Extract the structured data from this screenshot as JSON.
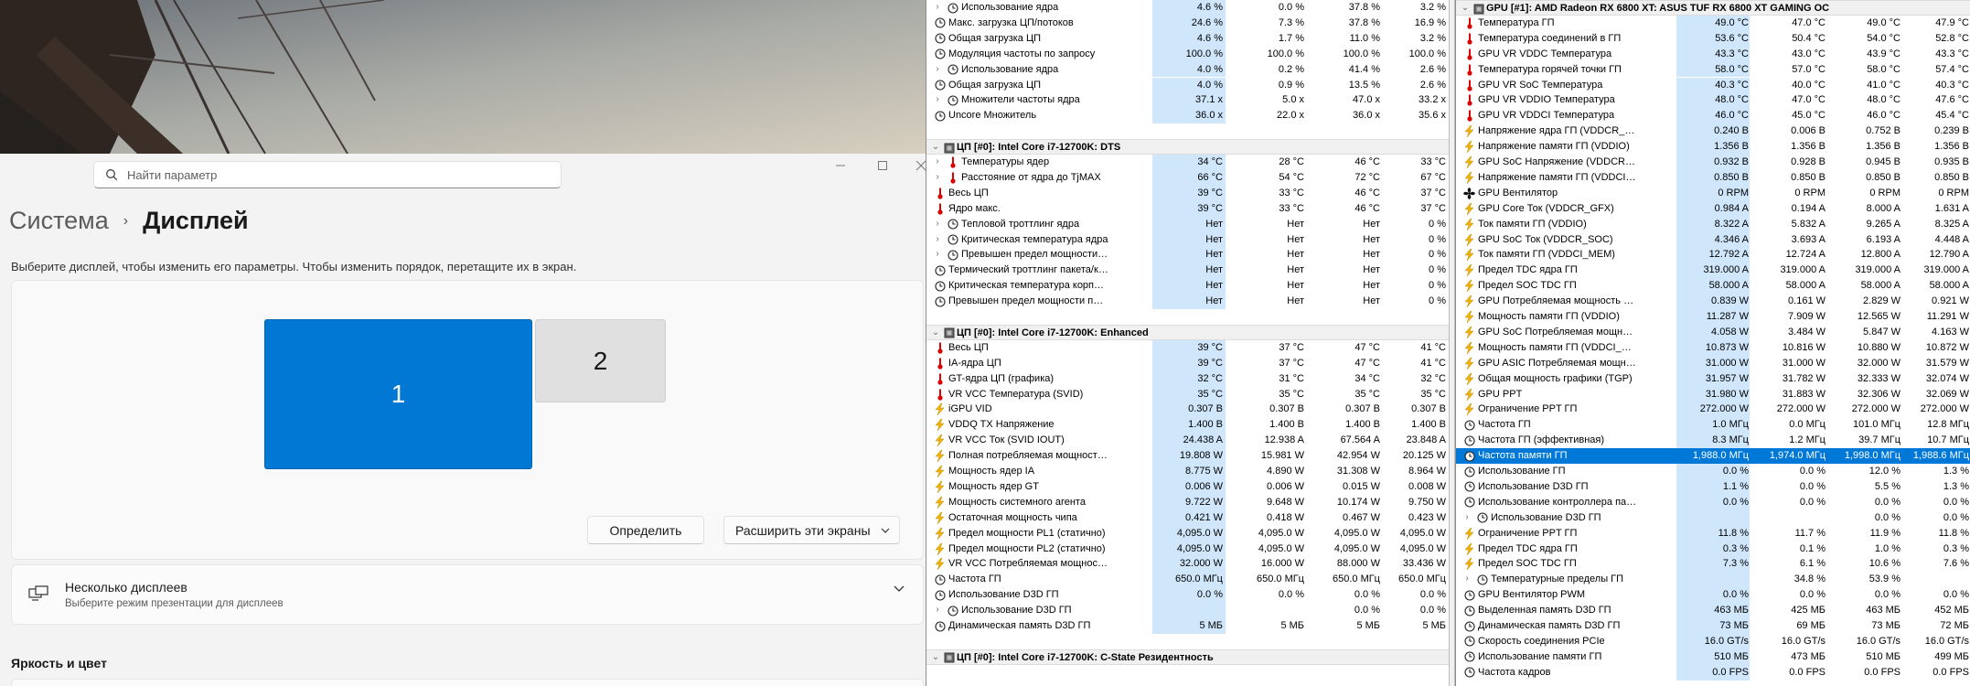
{
  "settings": {
    "search_placeholder": "Найти параметр",
    "breadcrumb_parent": "Система",
    "breadcrumb_current": "Дисплей",
    "description": "Выберите дисплей, чтобы изменить его параметры. Чтобы изменить порядок, перетащите их в экран.",
    "monitor1_label": "1",
    "monitor2_label": "2",
    "identify_button": "Определить",
    "extend_dropdown": "Расширить эти экраны",
    "multiple_displays_title": "Несколько дисплеев",
    "multiple_displays_subtitle": "Выберите режим презентации для дисплеев",
    "brightness_section": "Яркость и цвет"
  },
  "left_pane": {
    "rows": [
      {
        "t": "s",
        "ind": 1,
        "ex": "›",
        "ic": "clock",
        "name": "Использование ядра",
        "v": [
          "4.6 %",
          "0.0 %",
          "37.8 %",
          "3.2 %"
        ]
      },
      {
        "t": "s",
        "ind": 0,
        "ex": "",
        "ic": "clock",
        "name": "Макс. загрузка ЦП/потоков",
        "v": [
          "24.6 %",
          "7.3 %",
          "37.8 %",
          "16.9 %"
        ]
      },
      {
        "t": "s",
        "ind": 0,
        "ex": "",
        "ic": "clock",
        "name": "Общая загрузка ЦП",
        "v": [
          "4.6 %",
          "1.7 %",
          "11.0 %",
          "3.2 %"
        ]
      },
      {
        "t": "s",
        "ind": 0,
        "ex": "",
        "ic": "clock",
        "name": "Модуляция частоты по запросу",
        "v": [
          "100.0 %",
          "100.0 %",
          "100.0 %",
          "100.0 %"
        ]
      },
      {
        "t": "s",
        "ind": 1,
        "ex": "›",
        "ic": "clock",
        "name": "Использование ядра",
        "v": [
          "4.0 %",
          "0.2 %",
          "41.4 %",
          "2.6 %"
        ]
      },
      {
        "t": "s",
        "ind": 0,
        "ex": "",
        "ic": "clock",
        "name": "Общая загрузка ЦП",
        "v": [
          "4.0 %",
          "0.9 %",
          "13.5 %",
          "2.6 %"
        ]
      },
      {
        "t": "s",
        "ind": 1,
        "ex": "›",
        "ic": "clock",
        "name": "Множители частоты ядра",
        "v": [
          "37.1 x",
          "5.0 x",
          "47.0 x",
          "33.2 x"
        ]
      },
      {
        "t": "s",
        "ind": 0,
        "ex": "",
        "ic": "clock",
        "name": "Uncore Множитель",
        "v": [
          "36.0 x",
          "22.0 x",
          "36.0 x",
          "35.6 x"
        ]
      },
      {
        "t": "blank"
      },
      {
        "t": "h",
        "name": "ЦП [#0]: Intel Core i7-12700K: DTS"
      },
      {
        "t": "s",
        "ind": 1,
        "ex": "›",
        "ic": "therm",
        "name": "Температуры ядер",
        "v": [
          "34 °C",
          "28 °C",
          "46 °C",
          "33 °C"
        ]
      },
      {
        "t": "s",
        "ind": 1,
        "ex": "›",
        "ic": "therm",
        "name": "Расстояние от ядра до TjMAX",
        "v": [
          "66 °C",
          "54 °C",
          "72 °C",
          "67 °C"
        ]
      },
      {
        "t": "s",
        "ind": 0,
        "ex": "",
        "ic": "therm",
        "name": "Весь ЦП",
        "v": [
          "39 °C",
          "33 °C",
          "46 °C",
          "37 °C"
        ]
      },
      {
        "t": "s",
        "ind": 0,
        "ex": "",
        "ic": "therm",
        "name": "Ядро макс.",
        "v": [
          "39 °C",
          "33 °C",
          "46 °C",
          "37 °C"
        ]
      },
      {
        "t": "s",
        "ind": 1,
        "ex": "›",
        "ic": "clock",
        "name": "Тепловой троттлинг ядра",
        "v": [
          "Нет",
          "Нет",
          "Нет",
          "0 %"
        ]
      },
      {
        "t": "s",
        "ind": 1,
        "ex": "›",
        "ic": "clock",
        "name": "Критическая температура ядра",
        "v": [
          "Нет",
          "Нет",
          "Нет",
          "0 %"
        ]
      },
      {
        "t": "s",
        "ind": 1,
        "ex": "›",
        "ic": "clock",
        "name": "Превышен предел мощности ядра",
        "v": [
          "Нет",
          "Нет",
          "Нет",
          "0 %"
        ]
      },
      {
        "t": "s",
        "ind": 0,
        "ex": "",
        "ic": "clock",
        "name": "Термический троттлинг пакета/кольца",
        "v": [
          "Нет",
          "Нет",
          "Нет",
          "0 %"
        ]
      },
      {
        "t": "s",
        "ind": 0,
        "ex": "",
        "ic": "clock",
        "name": "Критическая температура корпуса/к...",
        "v": [
          "Нет",
          "Нет",
          "Нет",
          "0 %"
        ]
      },
      {
        "t": "s",
        "ind": 0,
        "ex": "",
        "ic": "clock",
        "name": "Превышен предел мощности пакета/...",
        "v": [
          "Нет",
          "Нет",
          "Нет",
          "0 %"
        ]
      },
      {
        "t": "blank"
      },
      {
        "t": "h",
        "name": "ЦП [#0]: Intel Core i7-12700K: Enhanced"
      },
      {
        "t": "s",
        "ind": 0,
        "ex": "",
        "ic": "therm",
        "name": "Весь ЦП",
        "v": [
          "39 °C",
          "37 °C",
          "47 °C",
          "41 °C"
        ]
      },
      {
        "t": "s",
        "ind": 0,
        "ex": "",
        "ic": "therm",
        "name": "IA-ядра ЦП",
        "v": [
          "39 °C",
          "37 °C",
          "47 °C",
          "41 °C"
        ]
      },
      {
        "t": "s",
        "ind": 0,
        "ex": "",
        "ic": "therm",
        "name": "GT-ядра ЦП (графика)",
        "v": [
          "32 °C",
          "31 °C",
          "34 °C",
          "32 °C"
        ]
      },
      {
        "t": "s",
        "ind": 0,
        "ex": "",
        "ic": "therm",
        "name": "VR VCC Температура (SVID)",
        "v": [
          "35 °C",
          "35 °C",
          "35 °C",
          "35 °C"
        ]
      },
      {
        "t": "s",
        "ind": 0,
        "ex": "",
        "ic": "bolt",
        "name": "iGPU VID",
        "v": [
          "0.307 В",
          "0.307 В",
          "0.307 В",
          "0.307 В"
        ]
      },
      {
        "t": "s",
        "ind": 0,
        "ex": "",
        "ic": "bolt",
        "name": "VDDQ TX Напряжение",
        "v": [
          "1.400 В",
          "1.400 В",
          "1.400 В",
          "1.400 В"
        ]
      },
      {
        "t": "s",
        "ind": 0,
        "ex": "",
        "ic": "bolt",
        "name": "VR VCC Ток (SVID IOUT)",
        "v": [
          "24.438 A",
          "12.938 A",
          "67.564 A",
          "23.848 A"
        ]
      },
      {
        "t": "s",
        "ind": 0,
        "ex": "",
        "ic": "bolt",
        "name": "Полная потребляемая мощность ЦП",
        "v": [
          "19.808 W",
          "15.981 W",
          "42.954 W",
          "20.125 W"
        ]
      },
      {
        "t": "s",
        "ind": 0,
        "ex": "",
        "ic": "bolt",
        "name": "Мощность ядер IA",
        "v": [
          "8.775 W",
          "4.890 W",
          "31.308 W",
          "8.964 W"
        ]
      },
      {
        "t": "s",
        "ind": 0,
        "ex": "",
        "ic": "bolt",
        "name": "Мощность ядер GT",
        "v": [
          "0.006 W",
          "0.006 W",
          "0.015 W",
          "0.008 W"
        ]
      },
      {
        "t": "s",
        "ind": 0,
        "ex": "",
        "ic": "bolt",
        "name": "Мощность системного агента",
        "v": [
          "9.722 W",
          "9.648 W",
          "10.174 W",
          "9.750 W"
        ]
      },
      {
        "t": "s",
        "ind": 0,
        "ex": "",
        "ic": "bolt",
        "name": "Остаточная мощность чипа",
        "v": [
          "0.421 W",
          "0.418 W",
          "0.467 W",
          "0.423 W"
        ]
      },
      {
        "t": "s",
        "ind": 0,
        "ex": "",
        "ic": "bolt",
        "name": "Предел мощности PL1 (статично)",
        "v": [
          "4,095.0 W",
          "4,095.0 W",
          "4,095.0 W",
          "4,095.0 W"
        ]
      },
      {
        "t": "s",
        "ind": 0,
        "ex": "",
        "ic": "bolt",
        "name": "Предел мощности PL2 (статично)",
        "v": [
          "4,095.0 W",
          "4,095.0 W",
          "4,095.0 W",
          "4,095.0 W"
        ]
      },
      {
        "t": "s",
        "ind": 0,
        "ex": "",
        "ic": "bolt",
        "name": "VR VCC Потребляемая мощность (SVI...",
        "v": [
          "32.000 W",
          "16.000 W",
          "88.000 W",
          "33.436 W"
        ]
      },
      {
        "t": "s",
        "ind": 0,
        "ex": "",
        "ic": "clock",
        "name": "Частота ГП",
        "v": [
          "650.0 МГц",
          "650.0 МГц",
          "650.0 МГц",
          "650.0 МГц"
        ]
      },
      {
        "t": "s",
        "ind": 0,
        "ex": "",
        "ic": "clock",
        "name": "Использование D3D ГП",
        "v": [
          "0.0 %",
          "0.0 %",
          "0.0 %",
          "0.0 %"
        ]
      },
      {
        "t": "s",
        "ind": 1,
        "ex": "›",
        "ic": "clock",
        "name": "Использование D3D ГП",
        "v": [
          "",
          "",
          "0.0 %",
          "0.0 %"
        ]
      },
      {
        "t": "s",
        "ind": 0,
        "ex": "",
        "ic": "clock",
        "name": "Динамическая память D3D ГП",
        "v": [
          "5 МБ",
          "5 МБ",
          "5 МБ",
          "5 МБ"
        ]
      },
      {
        "t": "blank"
      },
      {
        "t": "h",
        "name": "ЦП [#0]: Intel Core i7-12700K: C-State Резидентность"
      }
    ]
  },
  "right_pane": {
    "header": "GPU [#1]: AMD Radeon RX 6800 XT: ASUS TUF RX 6800 XT GAMING OC",
    "rows": [
      {
        "t": "s",
        "ind": 0,
        "ic": "therm",
        "name": "Температура ГП",
        "v": [
          "49.0 °C",
          "47.0 °C",
          "49.0 °C",
          "47.9 °C"
        ]
      },
      {
        "t": "s",
        "ind": 0,
        "ic": "therm",
        "name": "Температура соединений в ГП",
        "v": [
          "53.6 °C",
          "50.4 °C",
          "54.0 °C",
          "52.8 °C"
        ]
      },
      {
        "t": "s",
        "ind": 0,
        "ic": "therm",
        "name": "GPU VR VDDC Температура",
        "v": [
          "43.3 °C",
          "43.0 °C",
          "43.9 °C",
          "43.3 °C"
        ]
      },
      {
        "t": "s",
        "ind": 0,
        "ic": "therm",
        "name": "Температура горячей точки ГП",
        "v": [
          "58.0 °C",
          "57.0 °C",
          "58.0 °C",
          "57.4 °C"
        ]
      },
      {
        "t": "s",
        "ind": 0,
        "ic": "therm",
        "name": "GPU VR SoC Температура",
        "v": [
          "40.3 °C",
          "40.0 °C",
          "41.0 °C",
          "40.3 °C"
        ]
      },
      {
        "t": "s",
        "ind": 0,
        "ic": "therm",
        "name": "GPU VR VDDIO Температура",
        "v": [
          "48.0 °C",
          "47.0 °C",
          "48.0 °C",
          "47.6 °C"
        ]
      },
      {
        "t": "s",
        "ind": 0,
        "ic": "therm",
        "name": "GPU VR VDDCI Температура",
        "v": [
          "46.0 °C",
          "45.0 °C",
          "46.0 °C",
          "45.4 °C"
        ]
      },
      {
        "t": "s",
        "ind": 0,
        "ic": "bolt",
        "name": "Напряжение ядра ГП (VDDCR_GFX)",
        "v": [
          "0.240 В",
          "0.006 В",
          "0.752 В",
          "0.239 В"
        ]
      },
      {
        "t": "s",
        "ind": 0,
        "ic": "bolt",
        "name": "Напряжение памяти ГП (VDDIO)",
        "v": [
          "1.356 В",
          "1.356 В",
          "1.356 В",
          "1.356 В"
        ]
      },
      {
        "t": "s",
        "ind": 0,
        "ic": "bolt",
        "name": "GPU SoC Напряжение (VDDCR_SOC)",
        "v": [
          "0.932 В",
          "0.928 В",
          "0.945 В",
          "0.935 В"
        ]
      },
      {
        "t": "s",
        "ind": 0,
        "ic": "bolt",
        "name": "Напряжение памяти ГП (VDDCI_MEM)",
        "v": [
          "0.850 В",
          "0.850 В",
          "0.850 В",
          "0.850 В"
        ]
      },
      {
        "t": "s",
        "ind": 0,
        "ic": "fan",
        "name": "GPU Вентилятор",
        "v": [
          "0 RPM",
          "0 RPM",
          "0 RPM",
          "0 RPM"
        ]
      },
      {
        "t": "s",
        "ind": 0,
        "ic": "bolt",
        "name": "GPU Core Ток (VDDCR_GFX)",
        "v": [
          "0.984 A",
          "0.194 A",
          "8.000 A",
          "1.631 A"
        ]
      },
      {
        "t": "s",
        "ind": 0,
        "ic": "bolt",
        "name": "Ток памяти ГП (VDDIO)",
        "v": [
          "8.322 A",
          "5.832 A",
          "9.265 A",
          "8.325 A"
        ]
      },
      {
        "t": "s",
        "ind": 0,
        "ic": "bolt",
        "name": "GPU SoC Ток (VDDCR_SOC)",
        "v": [
          "4.346 A",
          "3.693 A",
          "6.193 A",
          "4.448 A"
        ]
      },
      {
        "t": "s",
        "ind": 0,
        "ic": "bolt",
        "name": "Ток памяти ГП (VDDCI_MEM)",
        "v": [
          "12.792 A",
          "12.724 A",
          "12.800 A",
          "12.790 A"
        ]
      },
      {
        "t": "s",
        "ind": 0,
        "ic": "bolt",
        "name": "Предел TDC ядра ГП",
        "v": [
          "319.000 A",
          "319.000 A",
          "319.000 A",
          "319.000 A"
        ]
      },
      {
        "t": "s",
        "ind": 0,
        "ic": "bolt",
        "name": "Предел SOC TDC ГП",
        "v": [
          "58.000 A",
          "58.000 A",
          "58.000 A",
          "58.000 A"
        ]
      },
      {
        "t": "s",
        "ind": 0,
        "ic": "bolt",
        "name": "GPU Потребляемая мощность ядра ...",
        "v": [
          "0.839 W",
          "0.161 W",
          "2.829 W",
          "0.921 W"
        ]
      },
      {
        "t": "s",
        "ind": 0,
        "ic": "bolt",
        "name": "Мощность памяти ГП (VDDIO)",
        "v": [
          "11.287 W",
          "7.909 W",
          "12.565 W",
          "11.291 W"
        ]
      },
      {
        "t": "s",
        "ind": 0,
        "ic": "bolt",
        "name": "GPU SoC Потребляемая мощность (...",
        "v": [
          "4.058 W",
          "3.484 W",
          "5.847 W",
          "4.163 W"
        ]
      },
      {
        "t": "s",
        "ind": 0,
        "ic": "bolt",
        "name": "Мощность памяти ГП (VDDCI_MEM)",
        "v": [
          "10.873 W",
          "10.816 W",
          "10.880 W",
          "10.872 W"
        ]
      },
      {
        "t": "s",
        "ind": 0,
        "ic": "bolt",
        "name": "GPU ASIC Потребляемая мощность",
        "v": [
          "31.000 W",
          "31.000 W",
          "32.000 W",
          "31.579 W"
        ]
      },
      {
        "t": "s",
        "ind": 0,
        "ic": "bolt",
        "name": "Общая мощность графики (TGP)",
        "v": [
          "31.957 W",
          "31.782 W",
          "32.333 W",
          "32.074 W"
        ]
      },
      {
        "t": "s",
        "ind": 0,
        "ic": "bolt",
        "name": "GPU PPT",
        "v": [
          "31.980 W",
          "31.883 W",
          "32.306 W",
          "32.069 W"
        ]
      },
      {
        "t": "s",
        "ind": 0,
        "ic": "bolt",
        "name": "Ограничение PPT ГП",
        "v": [
          "272.000 W",
          "272.000 W",
          "272.000 W",
          "272.000 W"
        ]
      },
      {
        "t": "s",
        "ind": 0,
        "ic": "clock",
        "name": "Частота ГП",
        "v": [
          "1.0 МГц",
          "0.0 МГц",
          "101.0 МГц",
          "12.8 МГц"
        ]
      },
      {
        "t": "s",
        "ind": 0,
        "ic": "clock",
        "name": "Частота ГП (эффективная)",
        "v": [
          "8.3 МГц",
          "1.2 МГц",
          "39.7 МГц",
          "10.7 МГц"
        ]
      },
      {
        "t": "sel",
        "ind": 0,
        "ic": "clock",
        "name": "Частота памяти ГП",
        "v": [
          "1,988.0 МГц",
          "1,974.0 МГц",
          "1,998.0 МГц",
          "1,988.6 МГц"
        ]
      },
      {
        "t": "s",
        "ind": 0,
        "ic": "clock",
        "name": "Использование ГП",
        "v": [
          "0.0 %",
          "0.0 %",
          "12.0 %",
          "1.3 %"
        ]
      },
      {
        "t": "s",
        "ind": 0,
        "ic": "clock",
        "name": "Использование D3D ГП",
        "v": [
          "1.1 %",
          "0.0 %",
          "5.5 %",
          "1.3 %"
        ]
      },
      {
        "t": "s",
        "ind": 0,
        "ic": "clock",
        "name": "Использование контроллера памят...",
        "v": [
          "0.0 %",
          "0.0 %",
          "0.0 %",
          "0.0 %"
        ]
      },
      {
        "t": "s",
        "ind": 1,
        "ex": "›",
        "ic": "clock",
        "name": "Использование D3D ГП",
        "v": [
          "",
          "",
          "0.0 %",
          "0.0 %"
        ]
      },
      {
        "t": "s",
        "ind": 0,
        "ic": "bolt",
        "name": "Ограничение PPT ГП",
        "v": [
          "11.8 %",
          "11.7 %",
          "11.9 %",
          "11.8 %"
        ]
      },
      {
        "t": "s",
        "ind": 0,
        "ic": "bolt",
        "name": "Предел TDC ядра ГП",
        "v": [
          "0.3 %",
          "0.1 %",
          "1.0 %",
          "0.3 %"
        ]
      },
      {
        "t": "s",
        "ind": 0,
        "ic": "bolt",
        "name": "Предел SOC TDC ГП",
        "v": [
          "7.3 %",
          "6.1 %",
          "10.6 %",
          "7.6 %"
        ]
      },
      {
        "t": "s",
        "ind": 1,
        "ex": "›",
        "ic": "clock",
        "name": "Температурные пределы ГП",
        "v": [
          "",
          "34.8 %",
          "53.9 %",
          ""
        ]
      },
      {
        "t": "s",
        "ind": 0,
        "ic": "clock",
        "name": "GPU Вентилятор PWM",
        "v": [
          "0.0 %",
          "0.0 %",
          "0.0 %",
          "0.0 %"
        ]
      },
      {
        "t": "s",
        "ind": 0,
        "ic": "clock",
        "name": "Выделенная память D3D ГП",
        "v": [
          "463 МБ",
          "425 МБ",
          "463 МБ",
          "452 МБ"
        ]
      },
      {
        "t": "s",
        "ind": 0,
        "ic": "clock",
        "name": "Динамическая память D3D ГП",
        "v": [
          "73 МБ",
          "69 МБ",
          "73 МБ",
          "72 МБ"
        ]
      },
      {
        "t": "s",
        "ind": 0,
        "ic": "clock",
        "name": "Скорость соединения PCIe",
        "v": [
          "16.0 GT/s",
          "16.0 GT/s",
          "16.0 GT/s",
          "16.0 GT/s"
        ]
      },
      {
        "t": "s",
        "ind": 0,
        "ic": "clock",
        "name": "Использование памяти ГП",
        "v": [
          "510 МБ",
          "473 МБ",
          "510 МБ",
          "499 МБ"
        ]
      },
      {
        "t": "s",
        "ind": 0,
        "ic": "clock",
        "name": "Частота кадров",
        "v": [
          "0.0 FPS",
          "0.0 FPS",
          "0.0 FPS",
          "0.0 FPS"
        ]
      }
    ]
  }
}
